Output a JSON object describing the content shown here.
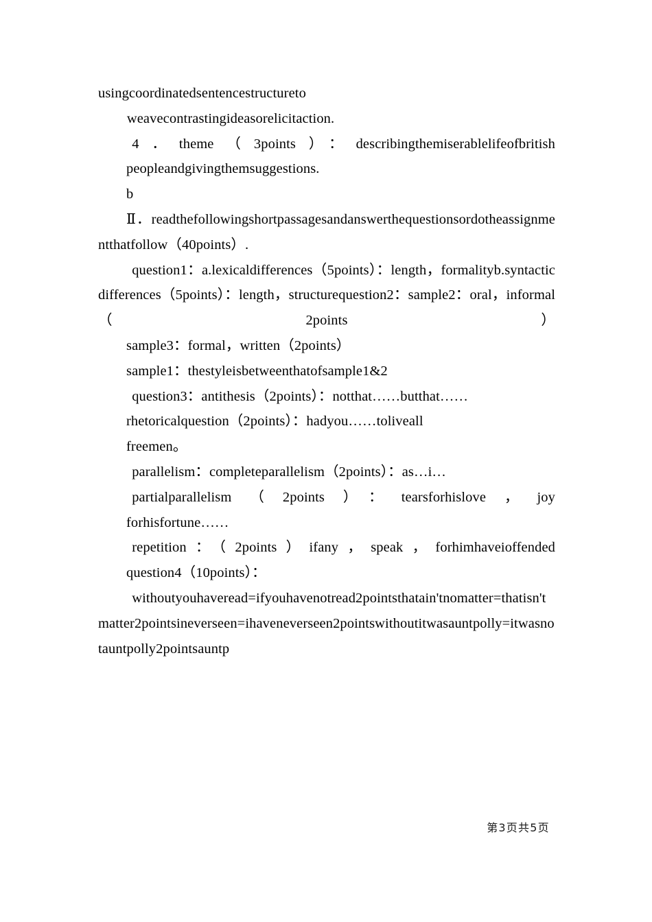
{
  "document": {
    "page_label": "第3页共5页",
    "blocks": [
      {
        "id": "b1",
        "text": "usingcoordinatedsentencestructureto\n        weavecontrastingideasorelicitaction."
      },
      {
        "id": "b2",
        "text": "4．theme（3points）：describingthemiserablelifeofbritish"
      },
      {
        "id": "b3",
        "text": "peopleandgivingthemsuggestions."
      },
      {
        "id": "b4",
        "text": "b"
      },
      {
        "id": "b5",
        "text": "Ⅱ．readthefollowingshortpassagesandanswerthequestionsordotheassignmentthatfollow（40points）."
      },
      {
        "id": "b6",
        "text": "question1：a.lexicaldifferences（5points）：length，formalityb.syntacticdifferences（5points）：length，structurequestion2：sample2：oral，informal（2points）"
      },
      {
        "id": "b7",
        "text": "sample3：formal，written（2points）"
      },
      {
        "id": "b8",
        "text": "sample1：thestyleisbetweenthatofsample1&2"
      },
      {
        "id": "b9",
        "text": "question3：antithesis（2points）：notthat……butthat……"
      },
      {
        "id": "b10",
        "text": "rhetoricalquestion（2points）：hadyou……toliveall"
      },
      {
        "id": "b11",
        "text": "freemen。"
      },
      {
        "id": "b12",
        "text": "parallelism：completeparallelism（2points）：as…i…"
      },
      {
        "id": "b13",
        "text": "partialparallelism（2points）：tearsforhislove，joy"
      },
      {
        "id": "b14",
        "text": "forhisfortune……"
      },
      {
        "id": "b15",
        "text": "repetition：（2points）ifany，speak，forhimhaveioffended"
      },
      {
        "id": "b16",
        "text": "question4（10points）："
      },
      {
        "id": "b17",
        "text": "withoutyouhaveread=ifyouhavenotread2pointsthatain'tnomatter=thatisn'tmatter2pointsineverseen=ihaveneverseen2pointswithoutitwasauntpolly=itwasnotauntpolly2pointsauntp"
      }
    ]
  }
}
